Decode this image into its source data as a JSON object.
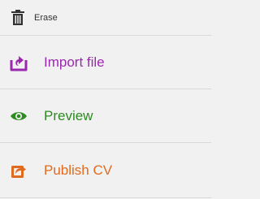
{
  "menu": {
    "items": [
      {
        "label": "Erase",
        "icon": "trash-icon",
        "color": "#333333"
      },
      {
        "label": "Import file",
        "icon": "import-icon",
        "color": "#9c27b0"
      },
      {
        "label": "Preview",
        "icon": "eye-icon",
        "color": "#2e8b22"
      },
      {
        "label": "Publish CV",
        "icon": "share-icon",
        "color": "#e06b1f"
      }
    ]
  }
}
